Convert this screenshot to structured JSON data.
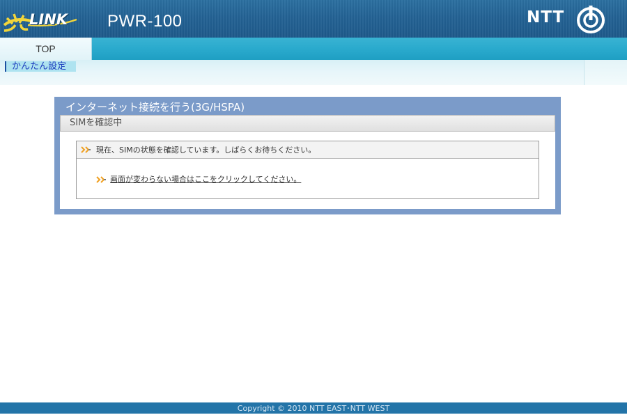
{
  "header": {
    "logo_text": "LINK",
    "product_name": "PWR-100",
    "brand": "NTT",
    "brand_mark_icon": "ntt-ring-icon",
    "logo_icon": "hikari-logo-icon"
  },
  "nav": {
    "tabs": [
      {
        "label": "TOP",
        "active": true
      }
    ],
    "subnav": [
      {
        "label": "かんたん設定",
        "active": true
      }
    ]
  },
  "panel": {
    "title": "インターネット接続を行う(3G/HSPA)",
    "subtitle": "SIMを確認中",
    "message": "現在、SIMの状態を確認しています。しばらくお待ちください。",
    "link_text": "画面が変わらない場合はここをクリックしてください。",
    "arrow_icon": "double-arrow-icon"
  },
  "footer": {
    "copyright": "Copyright © 2010 NTT EAST･NTT WEST"
  },
  "colors": {
    "header_bg": "#236294",
    "tab_bar": "#2aaacd",
    "panel_frame": "#7b9bc9",
    "accent_arrow": "#f0a020",
    "footer_bg": "#2374a8"
  }
}
